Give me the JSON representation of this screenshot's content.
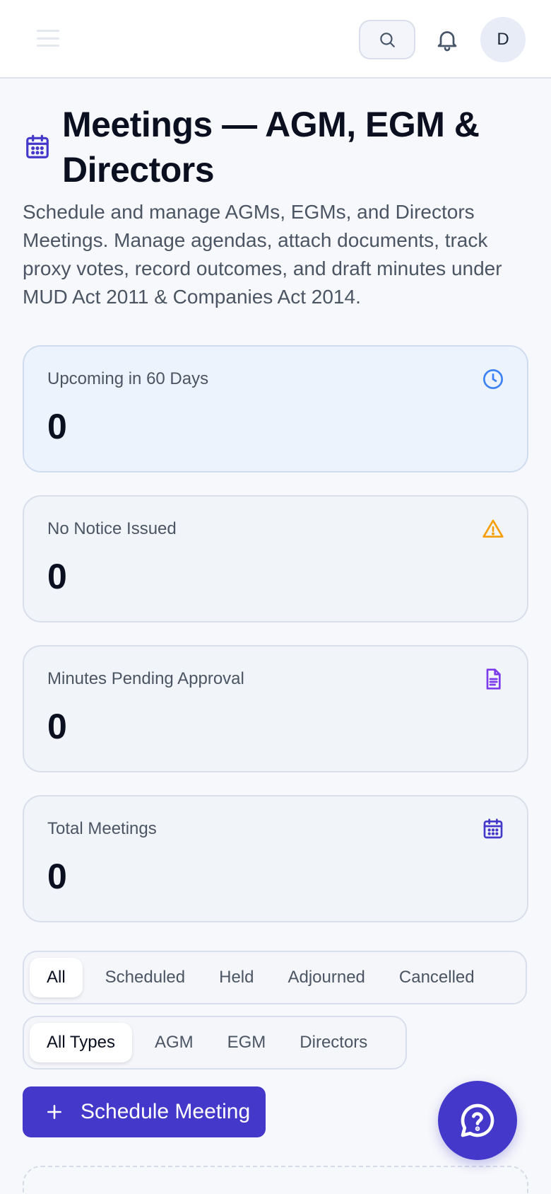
{
  "header": {
    "avatar_initial": "D",
    "icons": [
      "menu-icon",
      "search-icon",
      "bell-icon"
    ]
  },
  "page": {
    "title": "Meetings — AGM, EGM & Directors",
    "title_icon": "calendar-icon",
    "description": "Schedule and manage AGMs, EGMs, and Directors Meetings. Manage agendas, attach documents, track proxy votes, record outcomes, and draft minutes under MUD Act 2011 & Companies Act 2014."
  },
  "stats": [
    {
      "label": "Upcoming in 60 Days",
      "value": "0",
      "icon": "clock-icon",
      "color": "#3b82f6"
    },
    {
      "label": "No Notice Issued",
      "value": "0",
      "icon": "warning-icon",
      "color": "#f59e0b"
    },
    {
      "label": "Minutes Pending Approval",
      "value": "0",
      "icon": "document-icon",
      "color": "#7c3aed"
    },
    {
      "label": "Total Meetings",
      "value": "0",
      "icon": "calendar-icon",
      "color": "#4338ca"
    }
  ],
  "status_filter": {
    "selected": "All",
    "options": [
      "All",
      "Scheduled",
      "Held",
      "Adjourned",
      "Cancelled"
    ]
  },
  "type_filter": {
    "selected": "All Types",
    "options": [
      "All Types",
      "AGM",
      "EGM",
      "Directors"
    ]
  },
  "actions": {
    "schedule_label": "Schedule Meeting"
  },
  "colors": {
    "primary": "#4338ca",
    "page_bg": "#f7f8fb",
    "card_bg": "#f1f4f9",
    "highlight_card_bg": "#edf3fd"
  }
}
